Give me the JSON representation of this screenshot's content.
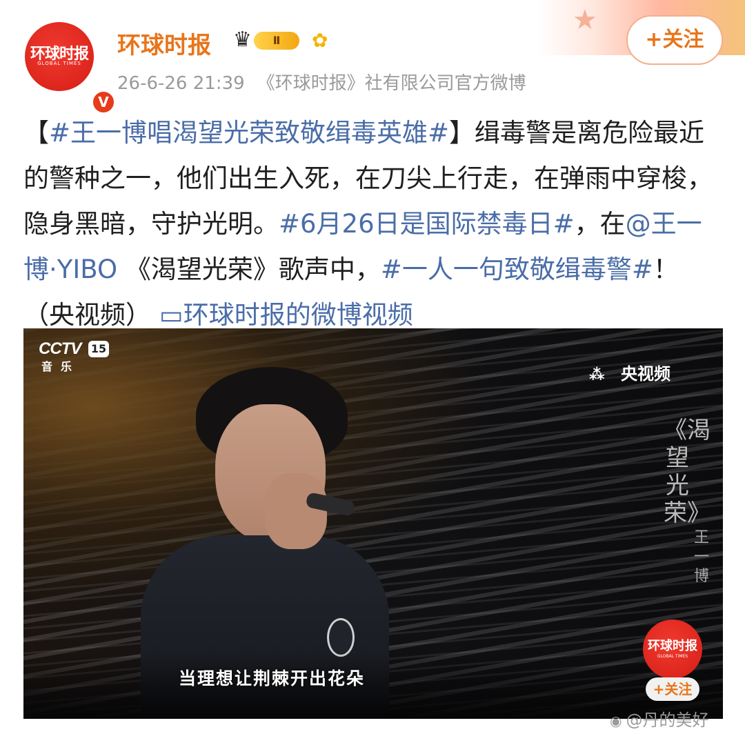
{
  "header": {
    "avatar_text": "环球时报",
    "avatar_subtext": "GLOBAL TIMES",
    "verified_mark": "V",
    "username": "环球时报",
    "vip_level": "Ⅱ",
    "vip_icon": "crown-icon",
    "flower_icon": "sunflower-icon",
    "time": "26-6-26 21:39",
    "source": "《环球时报》社有限公司官方微博",
    "follow_label": "+关注",
    "accent_color": "#e8751a"
  },
  "post": {
    "tag1": "#王一博唱渴望光荣致敬缉毒英雄#",
    "bracket_open": "【",
    "bracket_close": "】",
    "text1": "缉毒警是离危险最近的警种之一，他们出生入死，在刀尖上行走，在弹雨中穿梭，隐身黑暗，守护光明。",
    "tag2": "#6月26日是国际禁毒日#",
    "text2": "，在",
    "mention": "@王一博·YIBO",
    "text3": " 《渴望光荣》歌声中，",
    "tag3": "#一人一句致敬缉毒警#",
    "text4": "！（央视频）",
    "video_link_icon": "video-camera-icon",
    "video_link": "环球时报的微博视频",
    "link_color": "#4a6da8"
  },
  "video": {
    "channel_logo": "CCTV",
    "channel_number": "15",
    "channel_sub": "音乐",
    "platform_icon": "yangshipin-logo-icon",
    "platform": "央视频",
    "song_title": "《渴望光荣》",
    "artist": "王一博",
    "subtitle": "当理想让荆棘开出花朵",
    "watermark_logo": "环球时报",
    "watermark_logo_sub": "GLOBAL TIMES",
    "watermark_follow": "+关注"
  },
  "footer": {
    "weibo_icon": "weibo-icon",
    "watermark": "@丹的美好"
  }
}
